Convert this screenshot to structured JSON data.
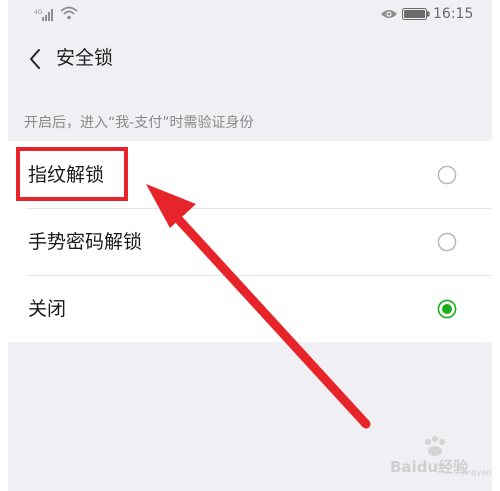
{
  "status_bar": {
    "time": "16:15",
    "icons": [
      "signal-icon",
      "wifi-icon",
      "eye-icon",
      "battery-icon"
    ]
  },
  "nav": {
    "title": "安全锁",
    "back_icon": "chevron-left-icon"
  },
  "hint": "开启后，进入“我-支付”时需验证身份",
  "options": [
    {
      "label": "指纹解锁",
      "selected": false
    },
    {
      "label": "手势密码解锁",
      "selected": false
    },
    {
      "label": "关闭",
      "selected": true
    }
  ],
  "colors": {
    "accent": "#1aad19",
    "annotation": "#e8242b",
    "background": "#efeff4"
  },
  "watermark": {
    "brand": "Baidu经验",
    "sub": "jingyan.baidu.com"
  }
}
